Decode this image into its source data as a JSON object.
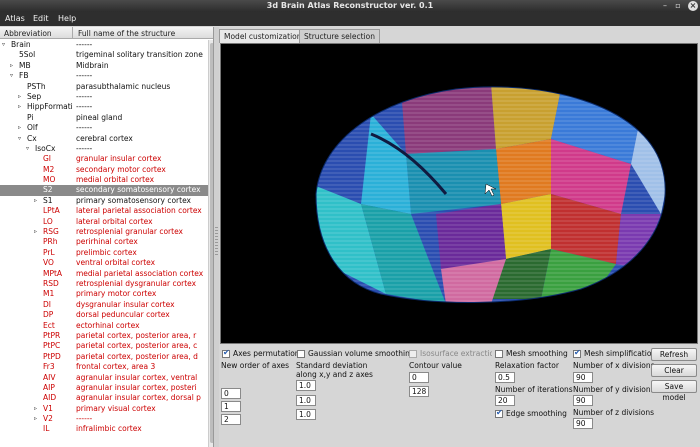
{
  "window": {
    "title": "3d Brain Atlas Reconstructor ver. 0.1"
  },
  "menu": [
    "Atlas",
    "Edit",
    "Help"
  ],
  "table": {
    "headers": [
      "Abbreviation",
      "Full name of the structure"
    ],
    "rows": [
      {
        "abbr": "Brain",
        "full": "------",
        "indent": 0,
        "arrow": "open",
        "style": "black"
      },
      {
        "abbr": "5Sol",
        "full": "trigeminal solitary transition zone",
        "indent": 1,
        "arrow": "none",
        "style": "black"
      },
      {
        "abbr": "MB",
        "full": "Midbrain",
        "indent": 1,
        "arrow": "closed",
        "style": "black"
      },
      {
        "abbr": "FB",
        "full": "------",
        "indent": 1,
        "arrow": "open",
        "style": "black"
      },
      {
        "abbr": "PSTh",
        "full": "parasubthalamic nucleus",
        "indent": 2,
        "arrow": "none",
        "style": "black"
      },
      {
        "abbr": "Sep",
        "full": "------",
        "indent": 2,
        "arrow": "closed",
        "style": "black"
      },
      {
        "abbr": "HippFormati",
        "full": "------",
        "indent": 2,
        "arrow": "closed",
        "style": "black"
      },
      {
        "abbr": "Pi",
        "full": "pineal gland",
        "indent": 2,
        "arrow": "none",
        "style": "black"
      },
      {
        "abbr": "Olf",
        "full": "------",
        "indent": 2,
        "arrow": "closed",
        "style": "black"
      },
      {
        "abbr": "Cx",
        "full": "cerebral cortex",
        "indent": 2,
        "arrow": "open",
        "style": "black"
      },
      {
        "abbr": "IsoCx",
        "full": "------",
        "indent": 3,
        "arrow": "open",
        "style": "black"
      },
      {
        "abbr": "GI",
        "full": "granular insular cortex",
        "indent": 4,
        "arrow": "none",
        "style": "red"
      },
      {
        "abbr": "M2",
        "full": "secondary motor cortex",
        "indent": 4,
        "arrow": "none",
        "style": "red"
      },
      {
        "abbr": "MO",
        "full": "medial orbital cortex",
        "indent": 4,
        "arrow": "none",
        "style": "red"
      },
      {
        "abbr": "S2",
        "full": "secondary somatosensory cortex",
        "indent": 4,
        "arrow": "none",
        "style": "sel"
      },
      {
        "abbr": "S1",
        "full": "primary somatosensory cortex",
        "indent": 4,
        "arrow": "closed",
        "style": "black"
      },
      {
        "abbr": "LPtA",
        "full": "lateral parietal association cortex",
        "indent": 4,
        "arrow": "none",
        "style": "red"
      },
      {
        "abbr": "LO",
        "full": "lateral orbital cortex",
        "indent": 4,
        "arrow": "none",
        "style": "red"
      },
      {
        "abbr": "RSG",
        "full": "retrosplenial granular cortex",
        "indent": 4,
        "arrow": "closed",
        "style": "red"
      },
      {
        "abbr": "PRh",
        "full": "perirhinal cortex",
        "indent": 4,
        "arrow": "none",
        "style": "red"
      },
      {
        "abbr": "PrL",
        "full": "prelimbic cortex",
        "indent": 4,
        "arrow": "none",
        "style": "red"
      },
      {
        "abbr": "VO",
        "full": "ventral orbital cortex",
        "indent": 4,
        "arrow": "none",
        "style": "red"
      },
      {
        "abbr": "MPtA",
        "full": "medial parietal association cortex",
        "indent": 4,
        "arrow": "none",
        "style": "red"
      },
      {
        "abbr": "RSD",
        "full": "retrosplenial dysgranular cortex",
        "indent": 4,
        "arrow": "none",
        "style": "red"
      },
      {
        "abbr": "M1",
        "full": "primary motor cortex",
        "indent": 4,
        "arrow": "none",
        "style": "red"
      },
      {
        "abbr": "DI",
        "full": "dysgranular insular cortex",
        "indent": 4,
        "arrow": "none",
        "style": "red"
      },
      {
        "abbr": "DP",
        "full": "dorsal peduncular cortex",
        "indent": 4,
        "arrow": "none",
        "style": "red"
      },
      {
        "abbr": "Ect",
        "full": "ectorhinal cortex",
        "indent": 4,
        "arrow": "none",
        "style": "red"
      },
      {
        "abbr": "PtPR",
        "full": "parietal cortex, posterior area, r",
        "indent": 4,
        "arrow": "none",
        "style": "red"
      },
      {
        "abbr": "PtPC",
        "full": "parietal cortex, posterior area, c",
        "indent": 4,
        "arrow": "none",
        "style": "red"
      },
      {
        "abbr": "PtPD",
        "full": "parietal cortex, posterior area, d",
        "indent": 4,
        "arrow": "none",
        "style": "red"
      },
      {
        "abbr": "Fr3",
        "full": "frontal cortex, area 3",
        "indent": 4,
        "arrow": "none",
        "style": "red"
      },
      {
        "abbr": "AIV",
        "full": "agranular insular cortex, ventral",
        "indent": 4,
        "arrow": "none",
        "style": "red"
      },
      {
        "abbr": "AIP",
        "full": "agranular insular cortex, posteri",
        "indent": 4,
        "arrow": "none",
        "style": "red"
      },
      {
        "abbr": "AID",
        "full": "agranular insular cortex, dorsal p",
        "indent": 4,
        "arrow": "none",
        "style": "red"
      },
      {
        "abbr": "V1",
        "full": "primary visual cortex",
        "indent": 4,
        "arrow": "closed",
        "style": "red"
      },
      {
        "abbr": "V2",
        "full": "------",
        "indent": 4,
        "arrow": "closed",
        "style": "red"
      },
      {
        "abbr": "IL",
        "full": "infralimbic cortex",
        "indent": 4,
        "arrow": "none",
        "style": "red"
      }
    ]
  },
  "tabs": [
    {
      "label": "Model customization",
      "active": true
    },
    {
      "label": "Structure selection",
      "active": false
    }
  ],
  "controls": {
    "axes_permutation": {
      "label": "Axes permutation",
      "checked": true
    },
    "gaussian_smoothing": {
      "label": "Gaussian volume smoothing",
      "checked": false
    },
    "isosurface_extraction": {
      "label": "Isosurface extraction",
      "checked": false
    },
    "mesh_smoothing": {
      "label": "Mesh smoothing",
      "checked": false
    },
    "mesh_simplification": {
      "label": "Mesh simplification",
      "checked": true
    },
    "new_order_of_axes": {
      "label": "New order of axes",
      "values": [
        "0",
        "1",
        "2"
      ]
    },
    "standard_deviation": {
      "label1": "Standard deviation",
      "label2": "along x,y and z axes",
      "values": [
        "1.0",
        "1.0",
        "1.0"
      ]
    },
    "contour_value": {
      "label": "Contour value",
      "values": [
        "0",
        "128"
      ]
    },
    "relaxation_factor": {
      "label": "Relaxation factor",
      "value": "0.5"
    },
    "number_of_iterations": {
      "label": "Number of iterations",
      "value": "20"
    },
    "edge_smoothing": {
      "label": "Edge smoothing",
      "checked": true
    },
    "x_divisions": {
      "label": "Number of x divisions",
      "value": "90"
    },
    "y_divisions": {
      "label": "Number of y divisions",
      "value": "90"
    },
    "z_divisions": {
      "label": "Number of z divisions",
      "value": "90"
    }
  },
  "buttons": {
    "refresh": "Refresh",
    "clear": "Clear",
    "save_model": "Save model"
  },
  "colors": {
    "selected_row": "#8a8a8a",
    "highlight_text": "#cc0000",
    "viewport_bg": "#000000"
  }
}
